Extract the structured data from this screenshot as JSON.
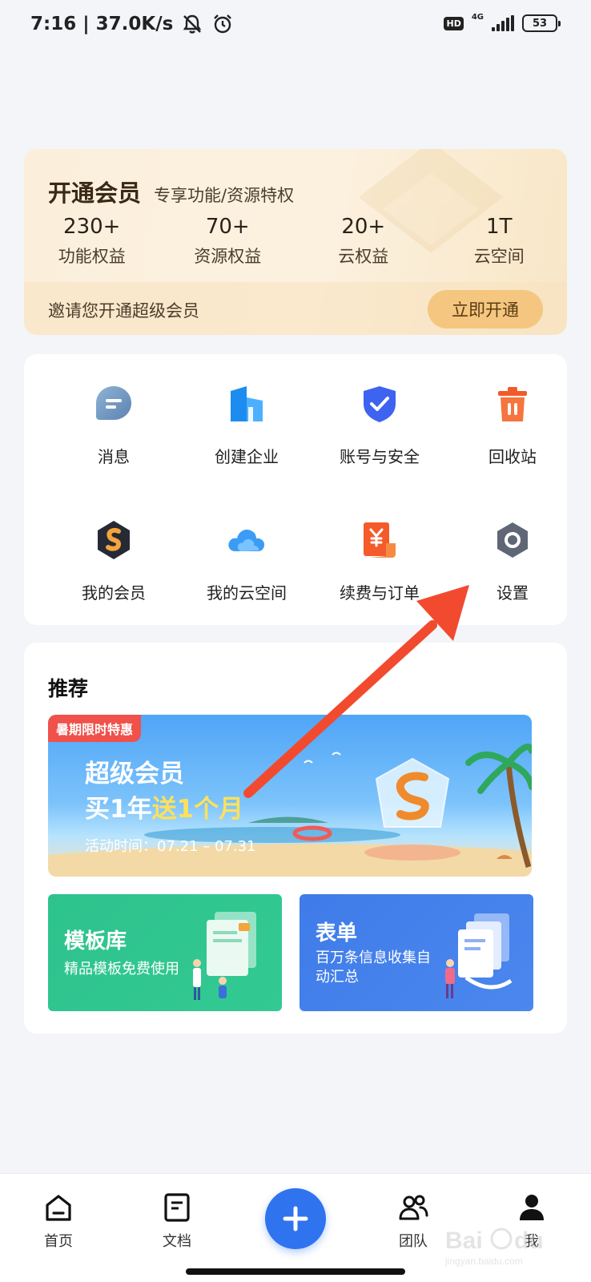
{
  "status_bar": {
    "time_speed": "7:16 | 37.0K/s",
    "network_badge": "HD",
    "network_type": "4G",
    "battery": "53"
  },
  "member": {
    "title": "开通会员",
    "subtitle": "专享功能/资源特权",
    "stats": [
      {
        "value": "230+",
        "label": "功能权益"
      },
      {
        "value": "70+",
        "label": "资源权益"
      },
      {
        "value": "20+",
        "label": "云权益"
      },
      {
        "value": "1T",
        "label": "云空间"
      }
    ],
    "invite_text": "邀请您开通超级会员",
    "open_button": "立即开通"
  },
  "features": [
    {
      "label": "消息",
      "icon": "message-icon"
    },
    {
      "label": "创建企业",
      "icon": "enterprise-icon"
    },
    {
      "label": "账号与安全",
      "icon": "shield-icon"
    },
    {
      "label": "回收站",
      "icon": "trash-icon"
    },
    {
      "label": "我的会员",
      "icon": "membership-icon"
    },
    {
      "label": "我的云空间",
      "icon": "cloud-icon"
    },
    {
      "label": "续费与订单",
      "icon": "order-icon"
    },
    {
      "label": "设置",
      "icon": "settings-icon"
    }
  ],
  "recommend": {
    "title": "推荐",
    "promo": {
      "tag": "暑期限时特惠",
      "line1": "超级会员",
      "line2_prefix": "买1年",
      "line2_highlight": "送1个月",
      "date": "活动时间：07.21 – 07.31"
    },
    "tiles": [
      {
        "title": "模板库",
        "subtitle": "精品模板免费使用"
      },
      {
        "title": "表单",
        "subtitle": "百万条信息收集自动汇总"
      }
    ]
  },
  "bottom_nav": {
    "items": [
      {
        "label": "首页",
        "icon": "home-icon"
      },
      {
        "label": "文档",
        "icon": "document-icon"
      },
      {
        "label": "团队",
        "icon": "team-icon"
      },
      {
        "label": "我",
        "icon": "profile-icon"
      }
    ],
    "add_icon": "plus-icon"
  },
  "colors": {
    "accent": "#2f73ef",
    "member_button": "#f4c67f",
    "arrow": "#f24a2f",
    "template_tile": "#2ec38e",
    "form_tile": "#3f7ce9"
  }
}
